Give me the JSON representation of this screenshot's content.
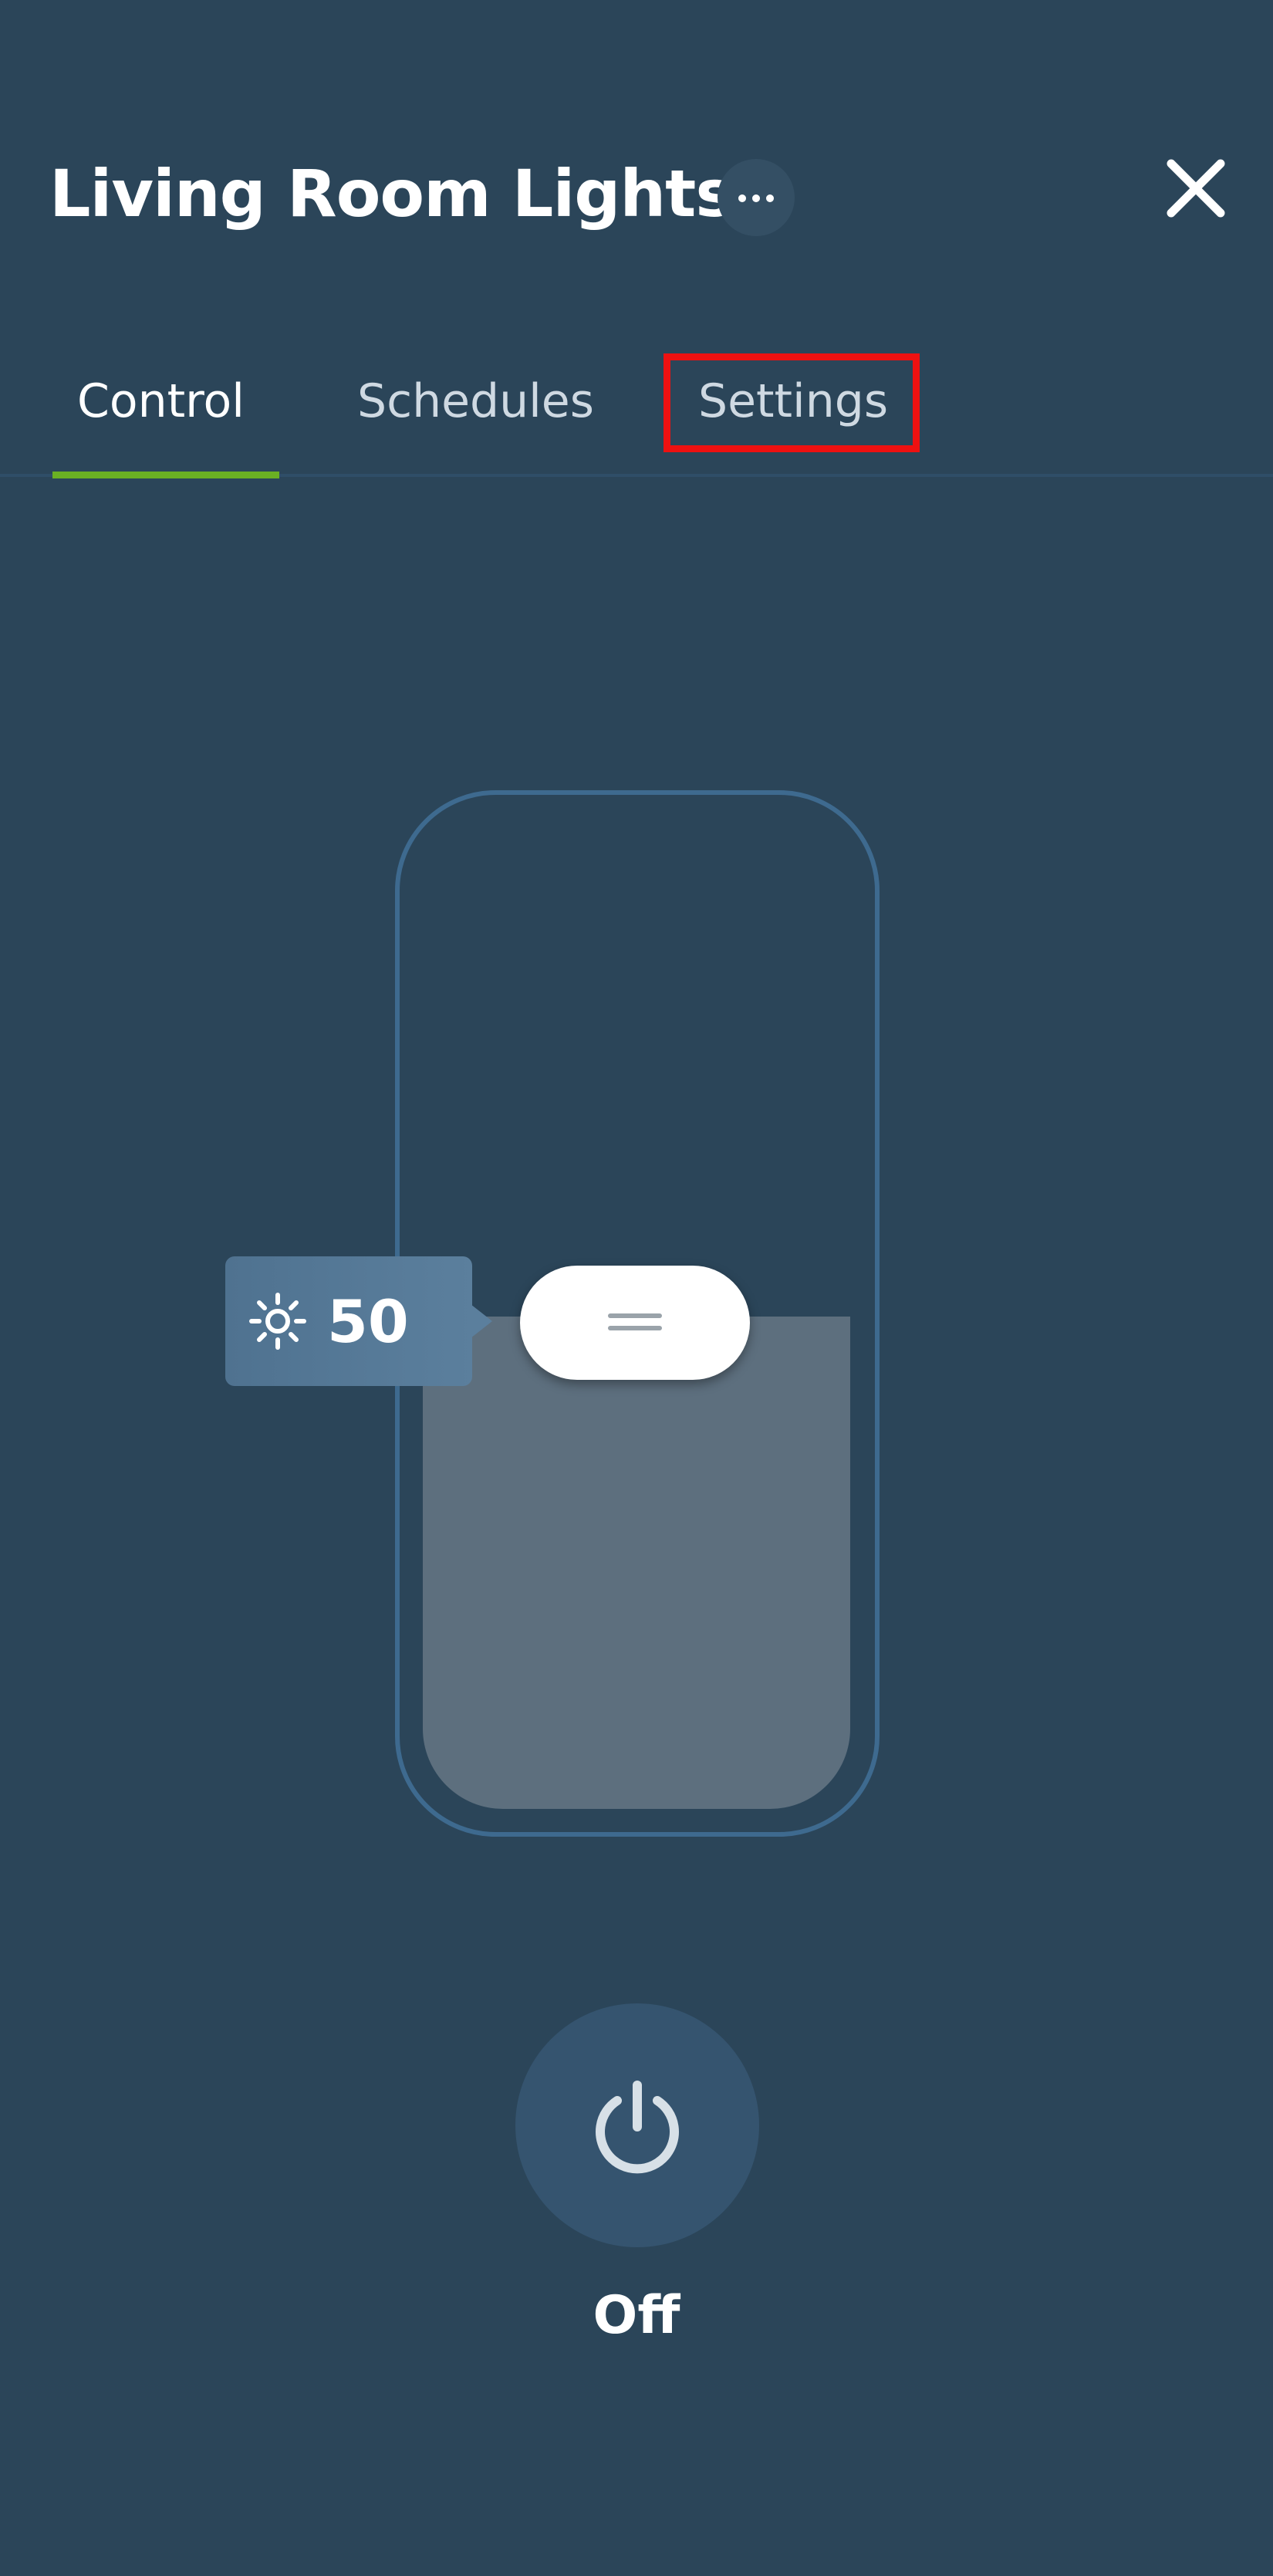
{
  "header": {
    "title": "Living Room Lights",
    "more_icon": "ellipsis-icon",
    "close_icon": "close-icon"
  },
  "tabs": [
    {
      "label": "Control",
      "active": true
    },
    {
      "label": "Schedules",
      "active": false
    },
    {
      "label": "Settings",
      "active": false,
      "highlighted": true
    }
  ],
  "brightness": {
    "icon": "sun-icon",
    "value": "50",
    "level_percent": 50
  },
  "power": {
    "icon": "power-icon",
    "status": "Off"
  },
  "colors": {
    "background": "#2b4559",
    "active_tab_accent": "#6ab023",
    "highlight_box": "#ee1111",
    "slider_border": "#3e6a8f",
    "slider_fill": "#5d6f7e",
    "power_button": "#35546f"
  }
}
